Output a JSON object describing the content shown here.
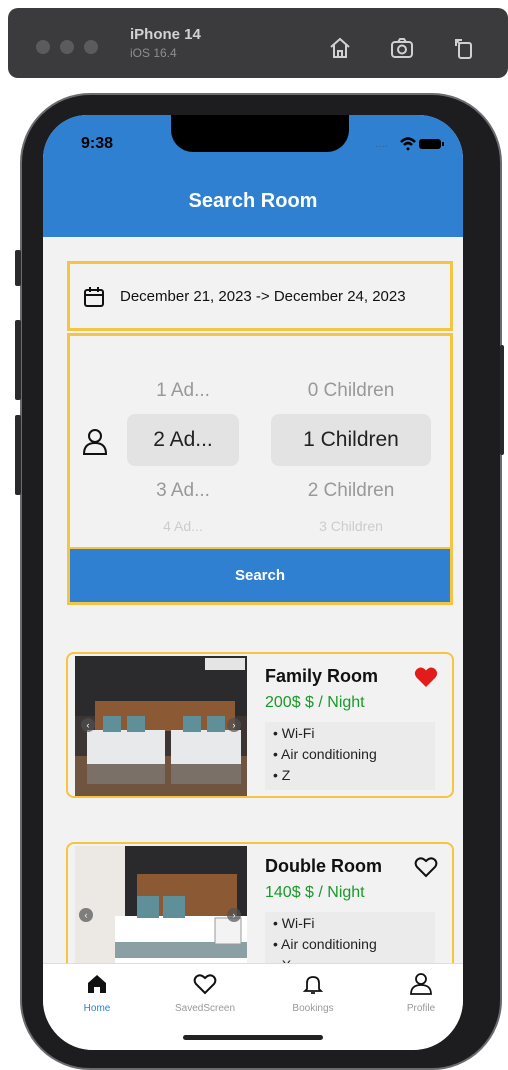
{
  "simulator": {
    "device": "iPhone 14",
    "os": "iOS 16.4"
  },
  "status_bar": {
    "time": "9:38",
    "signal": "...."
  },
  "header": {
    "title": "Search Room"
  },
  "search": {
    "date_range": "December 21, 2023 -> December 24, 2023",
    "adults_options": [
      "1 Ad...",
      "2 Ad...",
      "3 Ad...",
      "4 Ad..."
    ],
    "adults_selected": "2 Ad...",
    "children_options": [
      "0 Children",
      "1 Children",
      "2 Children",
      "3 Children"
    ],
    "children_selected": "1 Children",
    "button_label": "Search"
  },
  "rooms": [
    {
      "name": "Family Room",
      "price": "200$ $ / Night",
      "amenities": [
        "• Wi-Fi",
        "• Air conditioning",
        "• Z"
      ],
      "favorite": true
    },
    {
      "name": "Double Room",
      "price": "140$ $ / Night",
      "amenities": [
        "• Wi-Fi",
        "• Air conditioning",
        "• X"
      ],
      "favorite": false
    }
  ],
  "bottom_nav": {
    "items": [
      {
        "label": "Home",
        "icon": "home-icon",
        "active": true
      },
      {
        "label": "SavedScreen",
        "icon": "heart-icon",
        "active": false
      },
      {
        "label": "Bookings",
        "icon": "bell-icon",
        "active": false
      },
      {
        "label": "Profile",
        "icon": "person-icon",
        "active": false
      }
    ]
  },
  "colors": {
    "primary": "#2f80d1",
    "accent_border": "#f4c542",
    "price": "#1a9a2b",
    "favorite": "#e21b1b",
    "nav_active": "#2f80d1"
  }
}
